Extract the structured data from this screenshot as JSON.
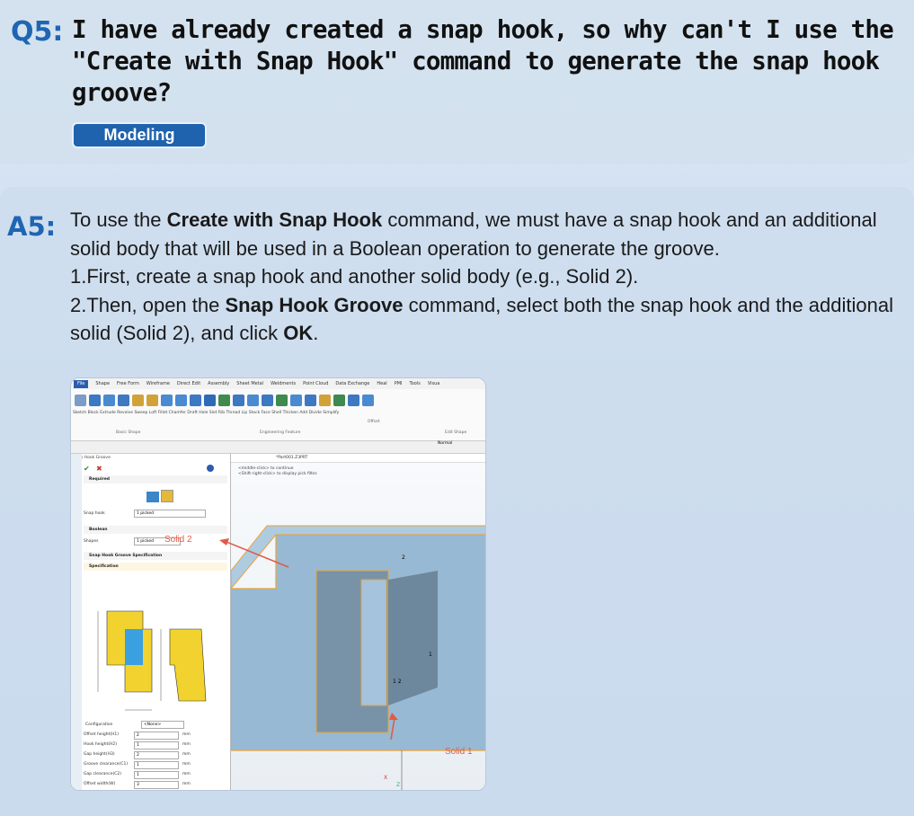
{
  "question": {
    "label": "Q5:",
    "text": "I have already created a snap hook, so why can't I use the \"Create with Snap Hook\" command to generate the snap hook groove?",
    "tag": "Modeling"
  },
  "answer": {
    "label": "A5:",
    "intro_a": "To use the ",
    "intro_b": "Create with Snap Hook",
    "intro_c": " command, we must have a snap hook and an additional solid body that will be used in a Boolean operation to generate the groove.",
    "step1": "1.First, create a snap hook and another solid body (e.g., Solid 2).",
    "step2_a": "2.Then, open the ",
    "step2_b": "Snap Hook Groove",
    "step2_c": " command, select both the snap hook and the additional solid (Solid 2), and click ",
    "step2_d": "OK",
    "step2_e": "."
  },
  "screenshot": {
    "menu": [
      "File",
      "Shape",
      "Free Form",
      "Wireframe",
      "Direct Edit",
      "Assembly",
      "Sheet Metal",
      "Weldments",
      "Point Cloud",
      "Data Exchange",
      "Heal",
      "PMI",
      "Tools",
      "Visua"
    ],
    "ribbon_labels": "Sketch  Block  Extrude  Revolve  Sweep  Loft     Fillet  Chamfer  Draft  Hole  Slot  Rib  Thread  Lip  Stock     Face   Shell  Thicken  Add  Divide  Simplify",
    "group_basic": "Basic Shape",
    "group_eng": "Engineering Feature",
    "group_edit": "Edit Shape",
    "face_offset": "Offset",
    "panel_title": "Snap Hook Groove",
    "required": "Required",
    "snap_hook": "Snap hook",
    "snap_hook_val": "1 picked",
    "boolean": "Boolean",
    "shapes": "Shapes",
    "shapes_val": "1 picked",
    "solid2": "Solid 2",
    "spec_header": "Snap Hook Groove Specification",
    "specification": "Specification",
    "params": [
      {
        "name": "Offset height(H1)",
        "value": "2",
        "unit": "mm"
      },
      {
        "name": "Hook height(H2)",
        "value": "1",
        "unit": "mm"
      },
      {
        "name": "Gap height(H3)",
        "value": "2",
        "unit": "mm"
      },
      {
        "name": "Groove clearance(C1)",
        "value": "1",
        "unit": "mm"
      },
      {
        "name": "Gap clearance(C2)",
        "value": "1",
        "unit": "mm"
      },
      {
        "name": "Offset width(W)",
        "value": "3",
        "unit": "mm"
      }
    ],
    "configuration": "Configuration",
    "config_val": "<None>",
    "tab_label": "*Part001.Z3PRT",
    "hint1": "<middle-click> to continue",
    "hint2": "<Shift-right-click> to display pick filter.",
    "filter": "Normal",
    "solid1": "Solid 1",
    "axis_x": "X",
    "axis_z": "Z",
    "lbl2": "2",
    "lbl1": "1",
    "lbl12": "1  2"
  },
  "colors": {
    "accent": "#1e66b3",
    "tag_bg": "#1f62ad",
    "annotation": "#e05a4a",
    "model": "#8fb3cf"
  }
}
